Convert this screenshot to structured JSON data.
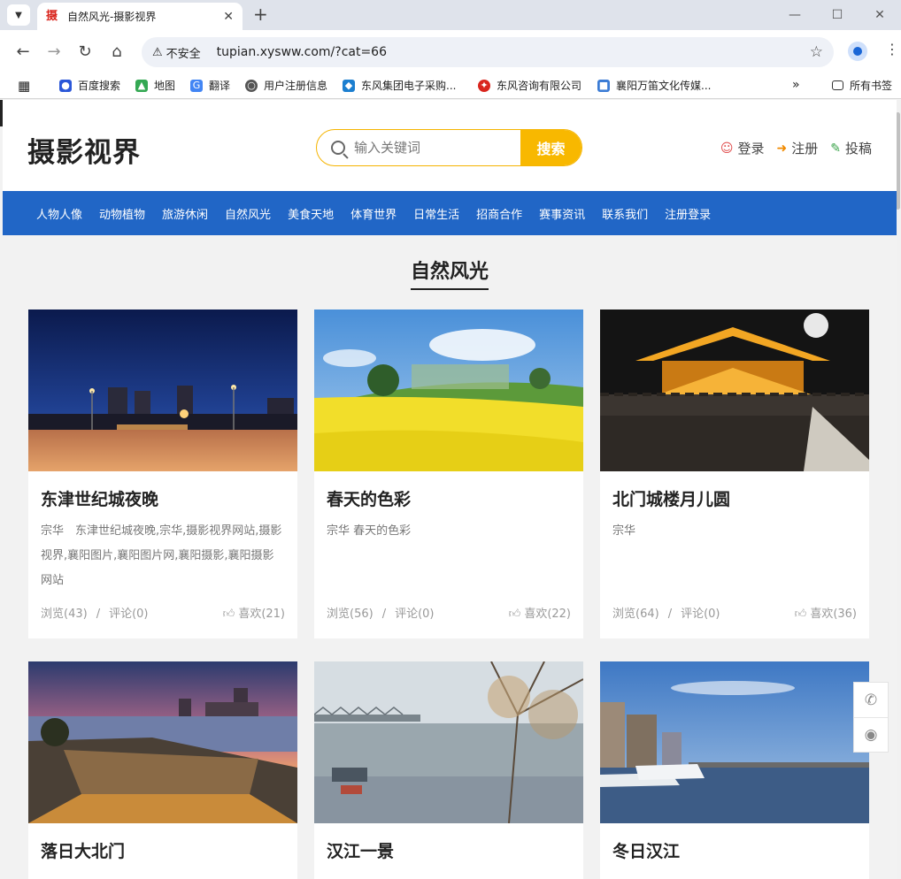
{
  "browser": {
    "tab_title": "自然风光-摄影视界",
    "favicon_text": "摄",
    "security_label": "不安全",
    "url": "tupian.xysww.com/?cat=66",
    "bookmarks": [
      "百度搜索",
      "地图",
      "翻译",
      "用户注册信息",
      "东风集团电子采购...",
      "东风咨询有限公司",
      "襄阳万笛文化传媒...",
      "所有书签"
    ],
    "bookmarks_more": "»"
  },
  "site": {
    "logo": "摄影视界",
    "search_placeholder": "输入关键词",
    "search_button": "搜索",
    "login": "登录",
    "register": "注册",
    "submit": "投稿"
  },
  "nav": [
    "人物人像",
    "动物植物",
    "旅游休闲",
    "自然风光",
    "美食天地",
    "体育世界",
    "日常生活",
    "招商合作",
    "赛事资讯",
    "联系我们",
    "注册登录"
  ],
  "section_title": "自然风光",
  "cards": [
    {
      "title": "东津世纪城夜晚",
      "desc": "宗华　东津世纪城夜晚,宗华,摄影视界网站,摄影视界,襄阳图片,襄阳图片网,襄阳摄影,襄阳摄影网站",
      "views": "浏览(43)",
      "comments": "评论(0)",
      "likes": "喜欢(21)"
    },
    {
      "title": "春天的色彩",
      "desc": "宗华 春天的色彩",
      "views": "浏览(56)",
      "comments": "评论(0)",
      "likes": "喜欢(22)"
    },
    {
      "title": "北门城楼月儿圆",
      "desc": "宗华",
      "views": "浏览(64)",
      "comments": "评论(0)",
      "likes": "喜欢(36)"
    },
    {
      "title": "落日大北门"
    },
    {
      "title": "汉江一景"
    },
    {
      "title": "冬日汉江"
    }
  ],
  "meta_separator": "/",
  "icons": {
    "login": "user-icon",
    "register": "sign-in-icon",
    "submit": "edit-icon",
    "like": "thumbs-up-icon",
    "float": [
      "phone-icon",
      "wechat-icon"
    ]
  },
  "colors": {
    "nav_bg": "#2166c6",
    "search_accent": "#f8b800"
  }
}
